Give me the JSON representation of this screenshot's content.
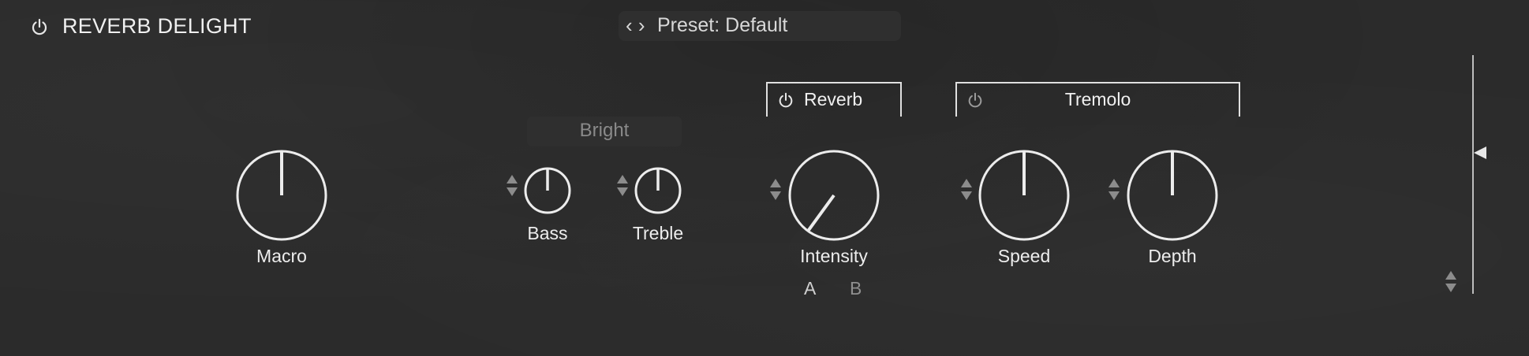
{
  "header": {
    "title": "REVERB DELIGHT",
    "preset_arrows": "‹ ›",
    "preset_label": "Preset: Default"
  },
  "controls": {
    "macro": {
      "label": "Macro",
      "value": 0.5
    },
    "bright": {
      "label": "Bright"
    },
    "bass": {
      "label": "Bass",
      "value": 0.5
    },
    "treble": {
      "label": "Treble",
      "value": 0.5
    },
    "reverb": {
      "title": "Reverb",
      "intensity": {
        "label": "Intensity",
        "value": 0.02
      },
      "ab": {
        "a": "A",
        "b": "B"
      }
    },
    "tremolo": {
      "title": "Tremolo",
      "speed": {
        "label": "Speed",
        "value": 0.5
      },
      "depth": {
        "label": "Depth",
        "value": 0.5
      }
    }
  },
  "output_meter": {
    "level": 0.59
  },
  "colors": {
    "background": "#2b2b2b",
    "foreground": "#ececec",
    "dim": "#8c8c8c"
  }
}
